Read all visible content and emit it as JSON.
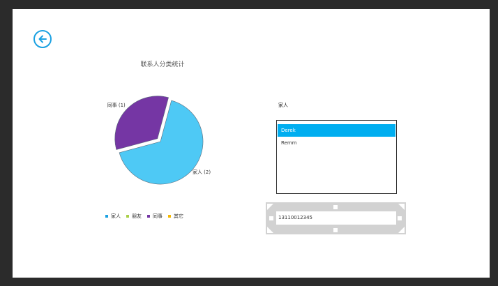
{
  "chart_data": {
    "type": "pie",
    "title": "联系人分类统计",
    "slices": [
      {
        "name": "家人",
        "value": 2,
        "label": "家人 (2)",
        "color": "#4ec9f5"
      },
      {
        "name": "朋友",
        "value": 0,
        "label": "",
        "color": "#a9cf47"
      },
      {
        "name": "同事",
        "value": 1,
        "label": "同事 (1)",
        "color": "#7536a4"
      },
      {
        "name": "其它",
        "value": 0,
        "label": "",
        "color": "#f5b800"
      }
    ],
    "legend_position": "bottom"
  },
  "legend": [
    {
      "label": "家人",
      "color": "#1ba1e2"
    },
    {
      "label": "朋友",
      "color": "#a9cf47"
    },
    {
      "label": "同事",
      "color": "#7536a4"
    },
    {
      "label": "其它",
      "color": "#f5b800"
    }
  ],
  "category": {
    "label": "家人"
  },
  "contacts": [
    {
      "name": "Derek",
      "selected": true
    },
    {
      "name": "Remm",
      "selected": false
    }
  ],
  "phone": {
    "value": "13110012345"
  },
  "icons": {
    "back": "back-arrow-icon"
  }
}
